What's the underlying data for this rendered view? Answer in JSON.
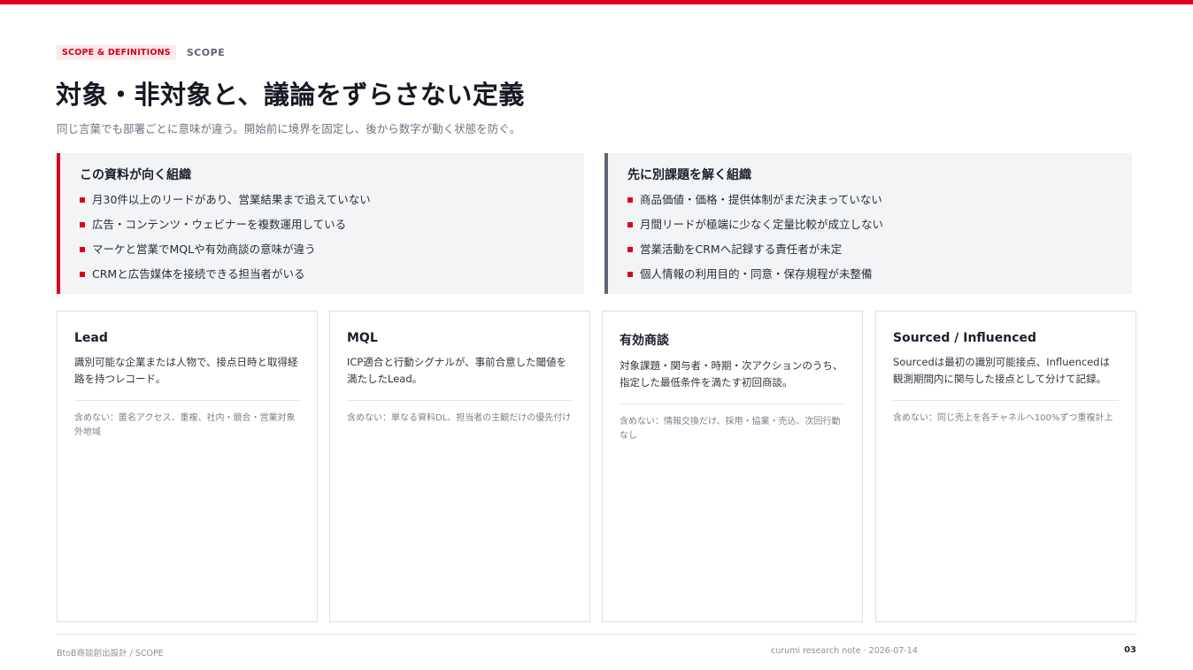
{
  "header": {
    "tag": "SCOPE & DEFINITIONS",
    "section": "SCOPE",
    "title": "対象・非対象と、議論をずらさない定義",
    "subtitle": "同じ言葉でも部署ごとに意味が違う。開始前に境界を固定し、後から数字が動く状態を防ぐ。"
  },
  "panels": {
    "fit": {
      "title": "この資料が向く組織",
      "items": [
        "月30件以上のリードがあり、営業結果まで追えていない",
        "広告・コンテンツ・ウェビナーを複数運用している",
        "マーケと営業でMQLや有効商談の意味が違う",
        "CRMと広告媒体を接続できる担当者がいる"
      ]
    },
    "unfit": {
      "title": "先に別課題を解く組織",
      "items": [
        "商品価値・価格・提供体制がまだ決まっていない",
        "月間リードが極端に少なく定量比較が成立しない",
        "営業活動をCRMへ記録する責任者が未定",
        "個人情報の利用目的・同意・保存規程が未整備"
      ]
    }
  },
  "definitions": [
    {
      "term": "Lead",
      "description": "識別可能な企業または人物で、接点日時と取得経路を持つレコード。",
      "exclusion": "含めない：匿名アクセス、重複、社内・競合・営業対象外地域"
    },
    {
      "term": "MQL",
      "description": "ICP適合と行動シグナルが、事前合意した閾値を満たしたLead。",
      "exclusion": "含めない：単なる資料DL、担当者の主観だけの優先付け"
    },
    {
      "term": "有効商談",
      "description": "対象課題・関与者・時期・次アクションのうち、指定した最低条件を満たす初回商談。",
      "exclusion": "含めない：情報交換だけ、採用・協業・売込、次回行動なし"
    },
    {
      "term": "Sourced / Influenced",
      "description": "Sourcedは最初の識別可能接点、Influencedは観測期間内に関与した接点として分けて記録。",
      "exclusion": "含めない：同じ売上を各チャネルへ100%ずつ重複計上"
    }
  ],
  "footer": {
    "left": "BtoB商談創出設計 / SCOPE",
    "middle": "curumi research note · 2026-07-14",
    "page": "03"
  },
  "colors": {
    "accent": "#e0001b",
    "neutral_bar": "#5f6675",
    "panel_bg": "#f3f4f6"
  }
}
